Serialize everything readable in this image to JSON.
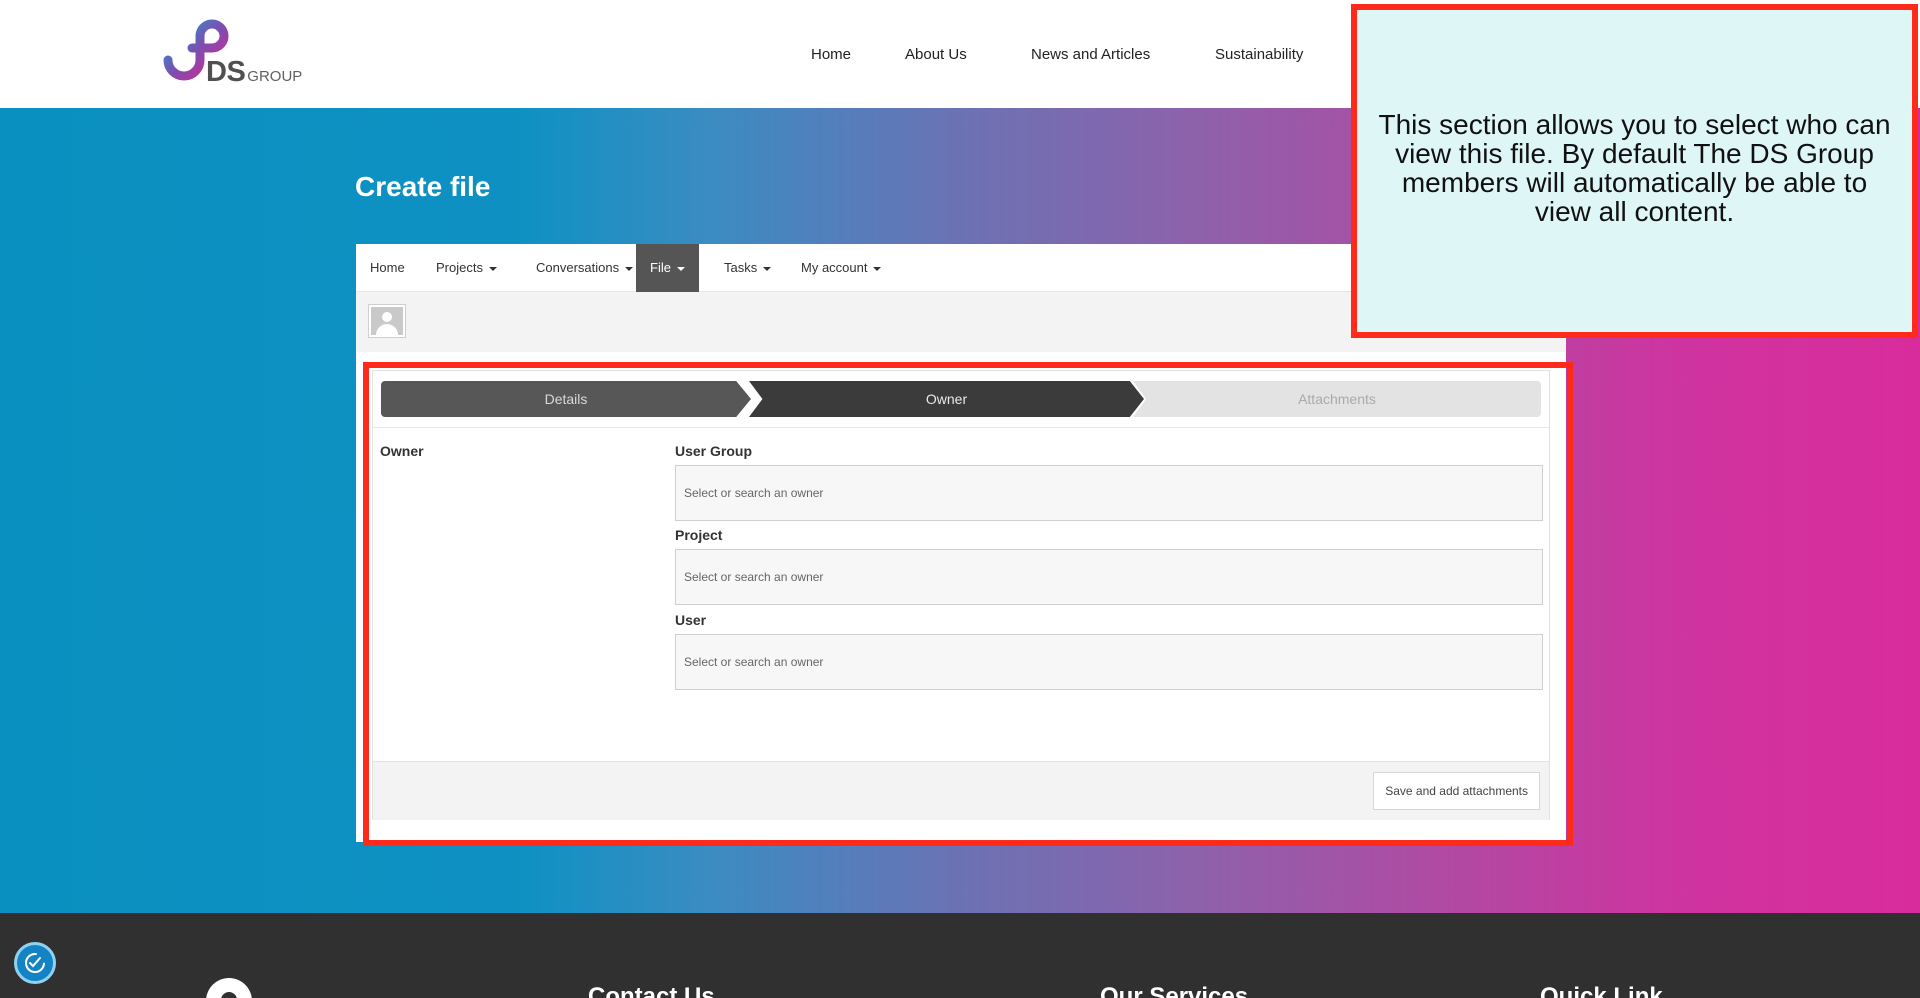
{
  "header": {
    "logo": {
      "ds": "DS",
      "group": "GROUP"
    },
    "nav": [
      {
        "label": "Home"
      },
      {
        "label": "About Us"
      },
      {
        "label": "News and Articles"
      },
      {
        "label": "Sustainability"
      }
    ]
  },
  "page": {
    "title": "Create file"
  },
  "app_nav": {
    "items": [
      {
        "label": "Home",
        "dropdown": false
      },
      {
        "label": "Projects",
        "dropdown": true
      },
      {
        "label": "Conversations",
        "dropdown": true
      },
      {
        "label": "File",
        "dropdown": true,
        "active": true
      },
      {
        "label": "Tasks",
        "dropdown": true
      },
      {
        "label": "My account",
        "dropdown": true
      }
    ]
  },
  "steps": [
    {
      "label": "Details",
      "state": "done"
    },
    {
      "label": "Owner",
      "state": "current"
    },
    {
      "label": "Attachments",
      "state": "pending"
    }
  ],
  "form": {
    "section_label": "Owner",
    "fields": [
      {
        "label": "User Group",
        "placeholder": "Select or search an owner"
      },
      {
        "label": "Project",
        "placeholder": "Select or search an owner"
      },
      {
        "label": "User",
        "placeholder": "Select or search an owner"
      }
    ],
    "submit_label": "Save and add attachments"
  },
  "callout": {
    "text": "This section allows you to select who can view this file. By default The DS Group members will automatically be able to view all content."
  },
  "footer": {
    "headings": [
      {
        "label": "Contact Us"
      },
      {
        "label": "Our Services"
      },
      {
        "label": "Quick Link"
      }
    ]
  },
  "icons": {
    "logo": "ds-group-logo",
    "avatar": "user-avatar-icon",
    "caret": "caret-down-icon",
    "accessibility": "accessibility-icon"
  },
  "colors": {
    "highlight": "#ff2a1a",
    "callout_bg": "#dff6f7",
    "hero_start": "#0a90c0",
    "hero_end": "#d92c9c",
    "footer_bg": "#303030",
    "active_tab": "#555555"
  }
}
